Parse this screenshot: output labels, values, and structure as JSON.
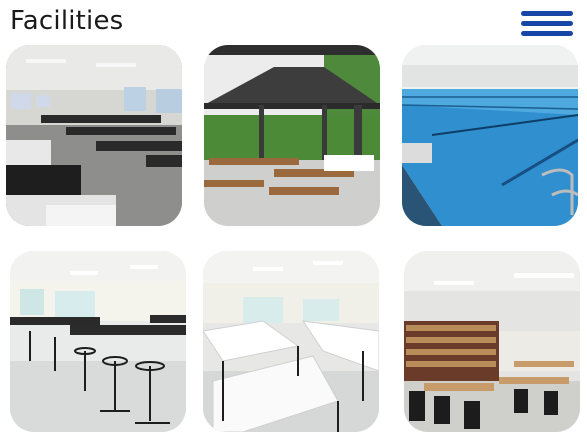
{
  "header": {
    "title": "Facilities",
    "menu_icon": "hamburger-menu-icon"
  },
  "colors": {
    "accent": "#1846a6",
    "title_text": "#1a1a1a",
    "background": "#ffffff"
  },
  "gallery": {
    "items": [
      {
        "name": "cafeteria-dining-hall-photo"
      },
      {
        "name": "outdoor-gazebo-picnic-area-photo"
      },
      {
        "name": "swimming-pool-photo"
      },
      {
        "name": "laboratory-stools-room-photo"
      },
      {
        "name": "drafting-tables-room-photo"
      },
      {
        "name": "library-reading-area-photo"
      }
    ]
  }
}
